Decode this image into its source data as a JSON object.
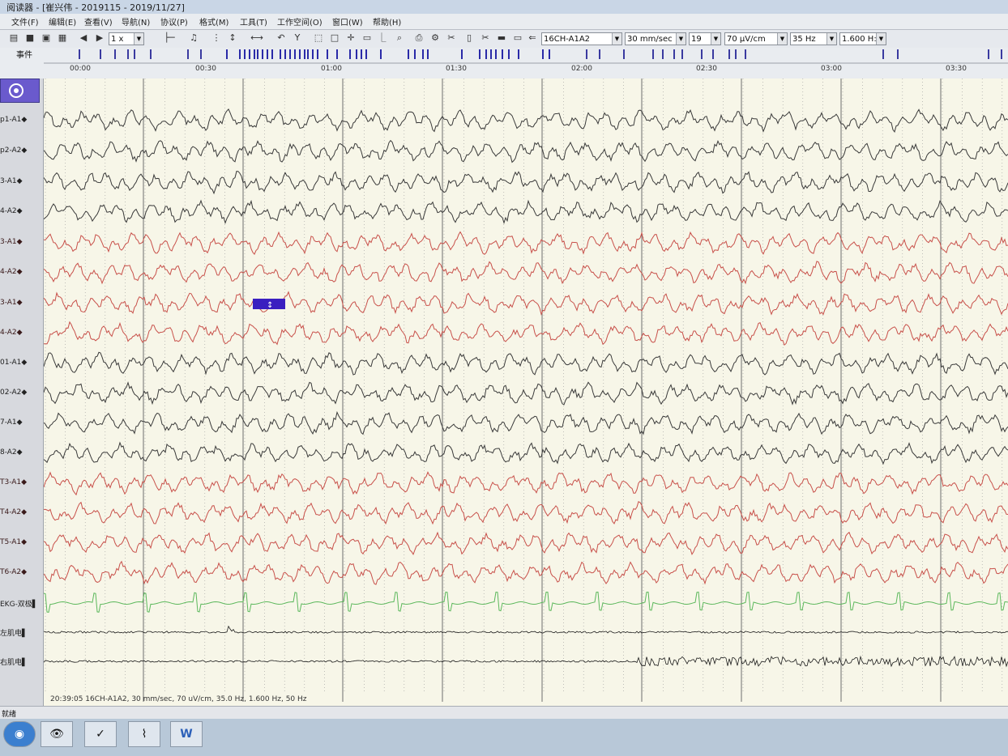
{
  "window": {
    "title": "阅读器 - [崔兴伟 - 2019115 - 2019/11/27]"
  },
  "menu": [
    "文件(F)",
    "编辑(E)",
    "查看(V)",
    "导航(N)",
    "协议(P)",
    "格式(M)",
    "工具(T)",
    "工作空间(O)",
    "窗口(W)",
    "帮助(H)"
  ],
  "toolbar": {
    "speed": "1 x",
    "montage": "16CH-A1A2",
    "paper_speed": "30 mm/sec",
    "channels": "19",
    "sensitivity": "70 µV/cm",
    "high_filter": "35 Hz",
    "low_filter": "1.600 H:"
  },
  "events": {
    "label": "事件",
    "time_labels": [
      "00:00",
      "00:30",
      "01:00",
      "01:30",
      "02:00",
      "02:30",
      "03:00",
      "03:30"
    ]
  },
  "channels": [
    "p1-A1",
    "p2-A2",
    "3-A1",
    "4-A2",
    "3-A1",
    "4-A2",
    "3-A1",
    "4-A2",
    "01-A1",
    "02-A2",
    "7-A1",
    "8-A2",
    "T3-A1",
    "T4-A2",
    "T5-A1",
    "T6-A2",
    "EKG-双极",
    "左肌电",
    "右肌电"
  ],
  "channel_types": [
    "black",
    "black",
    "black",
    "black",
    "red",
    "red",
    "red",
    "red",
    "black",
    "black",
    "black",
    "black",
    "red",
    "red",
    "red",
    "red",
    "green",
    "emg",
    "emg"
  ],
  "colors": {
    "black": "#3a3a3a",
    "red": "#c8504a",
    "green": "#5cb85c",
    "emg": "#1a1a1a",
    "accent": "#6a5acd",
    "grid": "#6e6e6e"
  },
  "status_info": "20:39:05 16CH-A1A2, 30 mm/sec, 70 uV/cm, 35.0 Hz, 1.600 Hz, 50 Hz",
  "statusbar": {
    "text": "就绪"
  },
  "taskbar": {
    "items": [
      "start-orb-icon",
      "eye-icon",
      "check-icon",
      "chart-icon",
      "word-icon"
    ]
  },
  "marker": {
    "label": "↕"
  }
}
